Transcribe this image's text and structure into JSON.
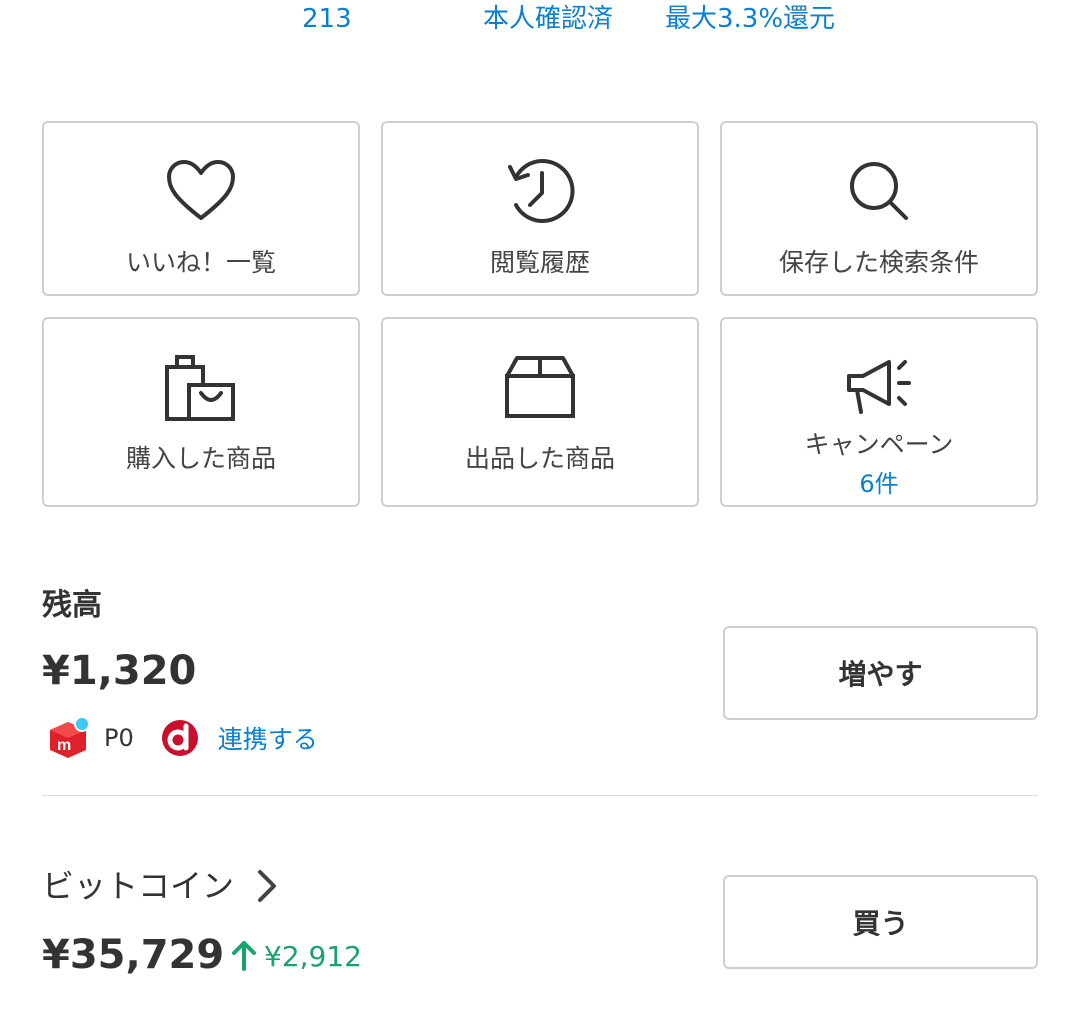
{
  "top_stats": {
    "count": "213",
    "verified": "本人確認済",
    "rate": "最大3.3%還元"
  },
  "menu": [
    {
      "label": "いいね！一覧",
      "icon": "heart-icon"
    },
    {
      "label": "閲覧履歴",
      "icon": "history-icon"
    },
    {
      "label": "保存した検索条件",
      "icon": "search-icon"
    },
    {
      "label": "購入した商品",
      "icon": "shopping-bag-icon"
    },
    {
      "label": "出品した商品",
      "icon": "box-icon"
    },
    {
      "label": "キャンペーン",
      "icon": "megaphone-icon",
      "count": "6件"
    }
  ],
  "balance": {
    "title": "残高",
    "amount": "¥1,320",
    "points": "P0",
    "link_label": "連携する",
    "increase_button": "増やす"
  },
  "bitcoin": {
    "title": "ビットコイン",
    "amount": "¥35,729",
    "change": "¥2,912",
    "buy_button": "買う"
  },
  "colors": {
    "link_blue": "#0b7fd0",
    "up_green": "#1aa26b",
    "mercari_red": "#e0202a",
    "docomo_red": "#c8102e"
  }
}
